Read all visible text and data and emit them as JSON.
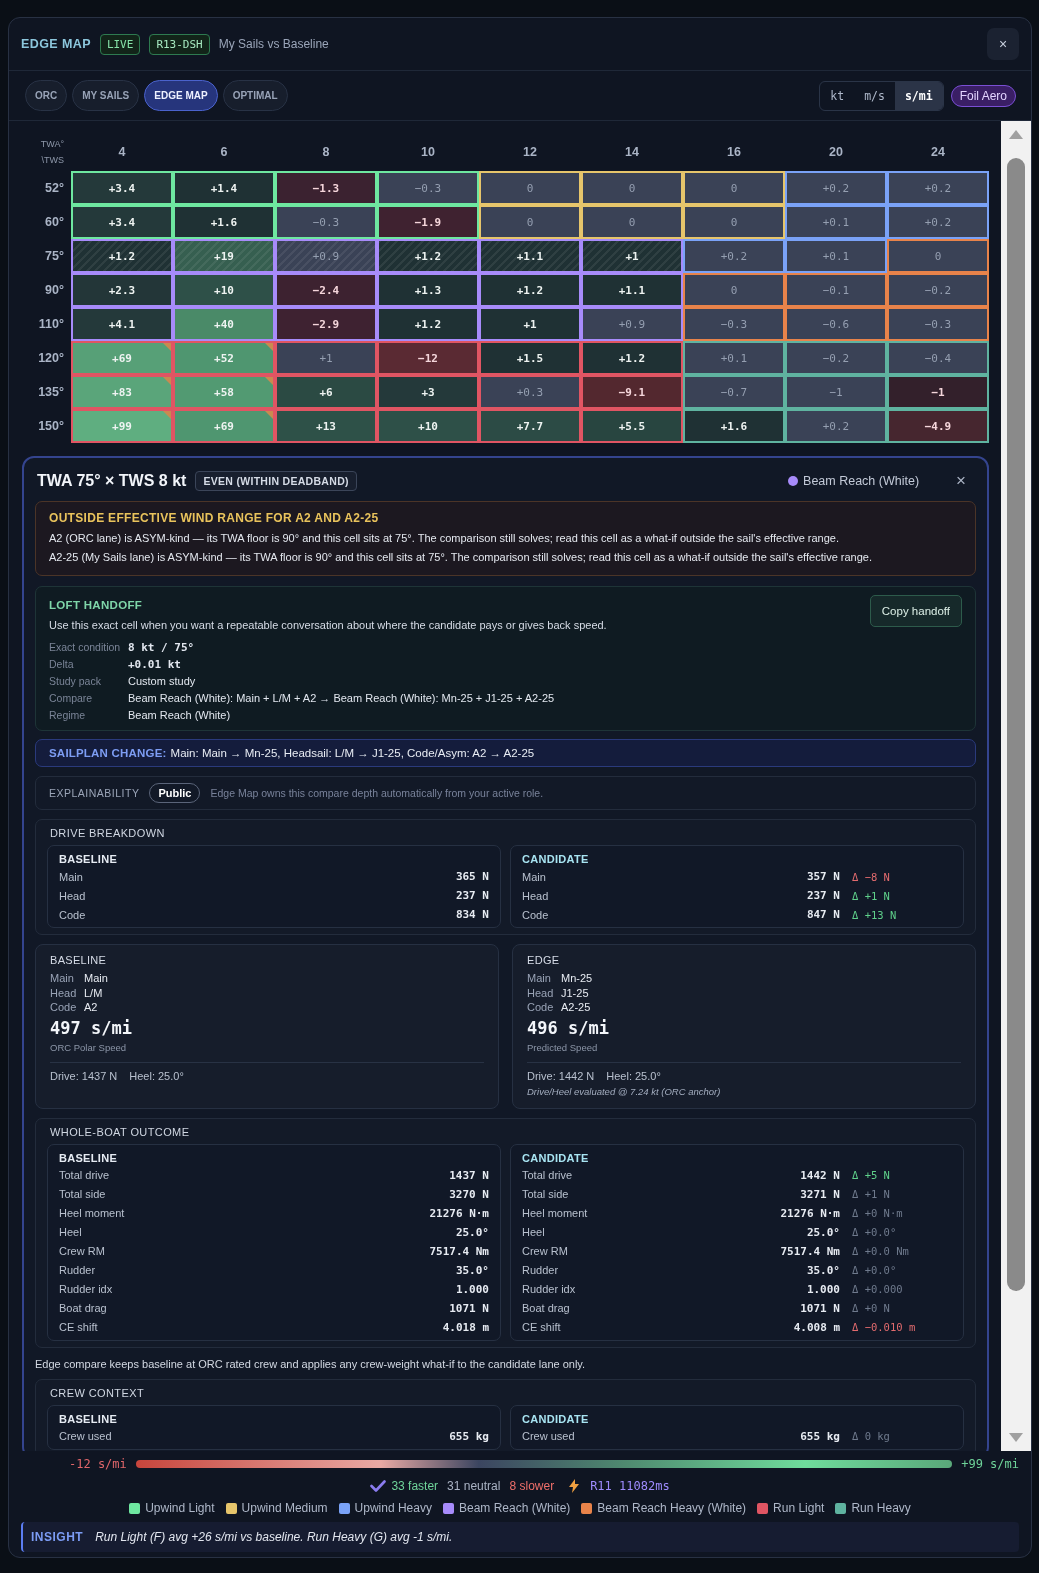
{
  "window": {
    "title": "EDGE MAP",
    "badges": [
      {
        "label": "LIVE",
        "kind": "live"
      },
      {
        "label": "R13-DSH",
        "kind": "code"
      }
    ],
    "subtitle": "My Sails vs Baseline",
    "close_label": "×"
  },
  "tabs": [
    {
      "label": "ORC",
      "selected": false
    },
    {
      "label": "MY SAILS",
      "selected": false
    },
    {
      "label": "EDGE MAP",
      "selected": true
    },
    {
      "label": "OPTIMAL",
      "selected": false
    }
  ],
  "units": [
    {
      "label": "kt",
      "selected": false
    },
    {
      "label": "m/s",
      "selected": false
    },
    {
      "label": "s/mi",
      "selected": true
    }
  ],
  "aero_badge": "Foil Aero",
  "grid": {
    "corner": [
      "TWA°",
      "\\TWS"
    ],
    "columns": [
      "4",
      "6",
      "8",
      "10",
      "12",
      "14",
      "16",
      "20",
      "24"
    ],
    "rows": [
      {
        "label": "52°",
        "cells": [
          {
            "value": "+3.4",
            "kind": "upwind_light",
            "color": "#24393a",
            "faster": true,
            "slower": false,
            "hatched": false,
            "flagged": false
          },
          {
            "value": "+1.4",
            "kind": "upwind_light",
            "color": "#1f3134",
            "faster": true,
            "slower": false,
            "hatched": false,
            "flagged": false
          },
          {
            "value": "−1.3",
            "kind": "upwind_light",
            "color": "#3b2230",
            "faster": false,
            "slower": true,
            "hatched": false,
            "flagged": false
          },
          {
            "value": "−0.3",
            "kind": "upwind_light",
            "color": "#3a4256",
            "faster": false,
            "slower": false,
            "hatched": false,
            "flagged": false
          },
          {
            "value": "0",
            "kind": "upwind_medium",
            "color": "#3a4256",
            "faster": false,
            "slower": false,
            "hatched": false,
            "flagged": false
          },
          {
            "value": "0",
            "kind": "upwind_medium",
            "color": "#3a4256",
            "faster": false,
            "slower": false,
            "hatched": false,
            "flagged": false
          },
          {
            "value": "0",
            "kind": "upwind_medium",
            "color": "#3a4256",
            "faster": false,
            "slower": false,
            "hatched": false,
            "flagged": false
          },
          {
            "value": "+0.2",
            "kind": "upwind_heavy",
            "color": "#3a4256",
            "faster": false,
            "slower": false,
            "hatched": false,
            "flagged": false
          },
          {
            "value": "+0.2",
            "kind": "upwind_heavy",
            "color": "#3a4256",
            "faster": false,
            "slower": false,
            "hatched": false,
            "flagged": false
          }
        ]
      },
      {
        "label": "60°",
        "cells": [
          {
            "value": "+3.4",
            "kind": "upwind_light",
            "color": "#24393a",
            "faster": true,
            "slower": false,
            "hatched": false,
            "flagged": false
          },
          {
            "value": "+1.6",
            "kind": "upwind_light",
            "color": "#1f3134",
            "faster": true,
            "slower": false,
            "hatched": false,
            "flagged": false
          },
          {
            "value": "−0.3",
            "kind": "upwind_light",
            "color": "#3a4256",
            "faster": false,
            "slower": false,
            "hatched": false,
            "flagged": false
          },
          {
            "value": "−1.9",
            "kind": "upwind_light",
            "color": "#3f2230",
            "faster": false,
            "slower": true,
            "hatched": false,
            "flagged": false
          },
          {
            "value": "0",
            "kind": "upwind_medium",
            "color": "#3a4256",
            "faster": false,
            "slower": false,
            "hatched": false,
            "flagged": false
          },
          {
            "value": "0",
            "kind": "upwind_medium",
            "color": "#3a4256",
            "faster": false,
            "slower": false,
            "hatched": false,
            "flagged": false
          },
          {
            "value": "0",
            "kind": "upwind_medium",
            "color": "#3a4256",
            "faster": false,
            "slower": false,
            "hatched": false,
            "flagged": false
          },
          {
            "value": "+0.1",
            "kind": "upwind_heavy",
            "color": "#3a4256",
            "faster": false,
            "slower": false,
            "hatched": false,
            "flagged": false
          },
          {
            "value": "+0.2",
            "kind": "upwind_heavy",
            "color": "#3a4256",
            "faster": false,
            "slower": false,
            "hatched": false,
            "flagged": false
          }
        ]
      },
      {
        "label": "75°",
        "cells": [
          {
            "value": "+1.2",
            "kind": "beam_reach",
            "color": "#1f3134",
            "faster": true,
            "slower": false,
            "hatched": true,
            "flagged": false
          },
          {
            "value": "+19",
            "kind": "beam_reach",
            "color": "#365f50",
            "faster": true,
            "slower": false,
            "hatched": true,
            "flagged": false
          },
          {
            "value": "+0.9",
            "kind": "beam_reach",
            "color": "#3a4256",
            "faster": false,
            "slower": false,
            "hatched": true,
            "flagged": false
          },
          {
            "value": "+1.2",
            "kind": "beam_reach",
            "color": "#1f3134",
            "faster": true,
            "slower": false,
            "hatched": true,
            "flagged": false
          },
          {
            "value": "+1.1",
            "kind": "beam_reach",
            "color": "#1f3134",
            "faster": true,
            "slower": false,
            "hatched": true,
            "flagged": false
          },
          {
            "value": "+1",
            "kind": "beam_reach",
            "color": "#1f3134",
            "faster": true,
            "slower": false,
            "hatched": true,
            "flagged": false
          },
          {
            "value": "+0.2",
            "kind": "upwind_heavy",
            "color": "#3a4256",
            "faster": false,
            "slower": false,
            "hatched": false,
            "flagged": false
          },
          {
            "value": "+0.1",
            "kind": "upwind_heavy",
            "color": "#3a4256",
            "faster": false,
            "slower": false,
            "hatched": false,
            "flagged": false
          },
          {
            "value": "0",
            "kind": "beam_reach_heavy",
            "color": "#3a4256",
            "faster": false,
            "slower": false,
            "hatched": false,
            "flagged": false
          }
        ]
      },
      {
        "label": "90°",
        "cells": [
          {
            "value": "+2.3",
            "kind": "beam_reach",
            "color": "#233638",
            "faster": true,
            "slower": false,
            "hatched": false,
            "flagged": false
          },
          {
            "value": "+10",
            "kind": "beam_reach",
            "color": "#2e5048",
            "faster": true,
            "slower": false,
            "hatched": false,
            "flagged": false
          },
          {
            "value": "−2.4",
            "kind": "beam_reach",
            "color": "#3d2230",
            "faster": false,
            "slower": true,
            "hatched": false,
            "flagged": false
          },
          {
            "value": "+1.3",
            "kind": "beam_reach",
            "color": "#1f3134",
            "faster": true,
            "slower": false,
            "hatched": false,
            "flagged": false
          },
          {
            "value": "+1.2",
            "kind": "beam_reach",
            "color": "#1f3134",
            "faster": true,
            "slower": false,
            "hatched": false,
            "flagged": false
          },
          {
            "value": "+1.1",
            "kind": "beam_reach",
            "color": "#1f3134",
            "faster": true,
            "slower": false,
            "hatched": false,
            "flagged": false
          },
          {
            "value": "0",
            "kind": "beam_reach_heavy",
            "color": "#3a4256",
            "faster": false,
            "slower": false,
            "hatched": false,
            "flagged": false
          },
          {
            "value": "−0.1",
            "kind": "beam_reach_heavy",
            "color": "#3a4256",
            "faster": false,
            "slower": false,
            "hatched": false,
            "flagged": false
          },
          {
            "value": "−0.2",
            "kind": "beam_reach_heavy",
            "color": "#3a4256",
            "faster": false,
            "slower": false,
            "hatched": false,
            "flagged": false
          }
        ]
      },
      {
        "label": "110°",
        "cells": [
          {
            "value": "+4.1",
            "kind": "beam_reach",
            "color": "#24393a",
            "faster": true,
            "slower": false,
            "hatched": false,
            "flagged": false
          },
          {
            "value": "+40",
            "kind": "beam_reach",
            "color": "#4a8a68",
            "faster": true,
            "slower": false,
            "hatched": false,
            "flagged": false
          },
          {
            "value": "−2.9",
            "kind": "beam_reach",
            "color": "#3e2231",
            "faster": false,
            "slower": true,
            "hatched": false,
            "flagged": false
          },
          {
            "value": "+1.2",
            "kind": "beam_reach",
            "color": "#1f3134",
            "faster": true,
            "slower": false,
            "hatched": false,
            "flagged": false
          },
          {
            "value": "+1",
            "kind": "beam_reach",
            "color": "#1f3134",
            "faster": true,
            "slower": false,
            "hatched": false,
            "flagged": false
          },
          {
            "value": "+0.9",
            "kind": "beam_reach",
            "color": "#3a4256",
            "faster": false,
            "slower": false,
            "hatched": false,
            "flagged": false
          },
          {
            "value": "−0.3",
            "kind": "beam_reach_heavy",
            "color": "#3a4256",
            "faster": false,
            "slower": false,
            "hatched": false,
            "flagged": false
          },
          {
            "value": "−0.6",
            "kind": "beam_reach_heavy",
            "color": "#3a4256",
            "faster": false,
            "slower": false,
            "hatched": false,
            "flagged": false
          },
          {
            "value": "−0.3",
            "kind": "beam_reach_heavy",
            "color": "#3a4256",
            "faster": false,
            "slower": false,
            "hatched": false,
            "flagged": false
          }
        ]
      },
      {
        "label": "120°",
        "cells": [
          {
            "value": "+69",
            "kind": "run_light",
            "color": "#57a077",
            "faster": true,
            "slower": false,
            "hatched": false,
            "flagged": true
          },
          {
            "value": "+52",
            "kind": "run_light",
            "color": "#4f9670",
            "faster": true,
            "slower": false,
            "hatched": false,
            "flagged": true
          },
          {
            "value": "+1",
            "kind": "run_light",
            "color": "#3a4256",
            "faster": false,
            "slower": false,
            "hatched": false,
            "flagged": false
          },
          {
            "value": "−12",
            "kind": "run_light",
            "color": "#5a2a33",
            "faster": false,
            "slower": true,
            "hatched": false,
            "flagged": false
          },
          {
            "value": "+1.5",
            "kind": "run_light",
            "color": "#1f3134",
            "faster": true,
            "slower": false,
            "hatched": false,
            "flagged": false
          },
          {
            "value": "+1.2",
            "kind": "run_light",
            "color": "#1f3134",
            "faster": true,
            "slower": false,
            "hatched": false,
            "flagged": false
          },
          {
            "value": "+0.1",
            "kind": "run_heavy",
            "color": "#3a4256",
            "faster": false,
            "slower": false,
            "hatched": false,
            "flagged": false
          },
          {
            "value": "−0.2",
            "kind": "run_heavy",
            "color": "#3a4256",
            "faster": false,
            "slower": false,
            "hatched": false,
            "flagged": false
          },
          {
            "value": "−0.4",
            "kind": "run_heavy",
            "color": "#3a4256",
            "faster": false,
            "slower": false,
            "hatched": false,
            "flagged": false
          }
        ]
      },
      {
        "label": "135°",
        "cells": [
          {
            "value": "+83",
            "kind": "run_light",
            "color": "#5aa57a",
            "faster": true,
            "slower": false,
            "hatched": false,
            "flagged": true
          },
          {
            "value": "+58",
            "kind": "run_light",
            "color": "#529a72",
            "faster": true,
            "slower": false,
            "hatched": false,
            "flagged": true
          },
          {
            "value": "+6",
            "kind": "run_light",
            "color": "#2b4a43",
            "faster": true,
            "slower": false,
            "hatched": false,
            "flagged": false
          },
          {
            "value": "+3",
            "kind": "run_light",
            "color": "#24393a",
            "faster": true,
            "slower": false,
            "hatched": false,
            "flagged": false
          },
          {
            "value": "+0.3",
            "kind": "run_light",
            "color": "#3a4256",
            "faster": false,
            "slower": false,
            "hatched": false,
            "flagged": false
          },
          {
            "value": "−9.1",
            "kind": "run_light",
            "color": "#53282f",
            "faster": false,
            "slower": true,
            "hatched": false,
            "flagged": false
          },
          {
            "value": "−0.7",
            "kind": "run_heavy",
            "color": "#3a4256",
            "faster": false,
            "slower": false,
            "hatched": false,
            "flagged": false
          },
          {
            "value": "−1",
            "kind": "run_heavy",
            "color": "#3a4256",
            "faster": false,
            "slower": false,
            "hatched": false,
            "flagged": false
          },
          {
            "value": "−1",
            "kind": "run_heavy",
            "color": "#33202b",
            "faster": false,
            "slower": true,
            "hatched": false,
            "flagged": false
          }
        ]
      },
      {
        "label": "150°",
        "cells": [
          {
            "value": "+99",
            "kind": "run_light",
            "color": "#5fae80",
            "faster": true,
            "slower": false,
            "hatched": false,
            "flagged": true
          },
          {
            "value": "+69",
            "kind": "run_light",
            "color": "#4f9670",
            "faster": true,
            "slower": false,
            "hatched": false,
            "flagged": true
          },
          {
            "value": "+13",
            "kind": "run_light",
            "color": "#2e5148",
            "faster": true,
            "slower": false,
            "hatched": false,
            "flagged": false
          },
          {
            "value": "+10",
            "kind": "run_light",
            "color": "#2e5048",
            "faster": true,
            "slower": false,
            "hatched": false,
            "flagged": false
          },
          {
            "value": "+7.7",
            "kind": "run_light",
            "color": "#2c4b45",
            "faster": true,
            "slower": false,
            "hatched": false,
            "flagged": false
          },
          {
            "value": "+5.5",
            "kind": "run_light",
            "color": "#284540",
            "faster": true,
            "slower": false,
            "hatched": false,
            "flagged": false
          },
          {
            "value": "+1.6",
            "kind": "run_heavy",
            "color": "#1f3134",
            "faster": true,
            "slower": false,
            "hatched": false,
            "flagged": false
          },
          {
            "value": "+0.2",
            "kind": "run_heavy",
            "color": "#3a4256",
            "faster": false,
            "slower": false,
            "hatched": false,
            "flagged": false
          },
          {
            "value": "−4.9",
            "kind": "run_heavy",
            "color": "#46262f",
            "faster": false,
            "slower": true,
            "hatched": false,
            "flagged": false
          }
        ]
      }
    ]
  },
  "detail": {
    "title": "TWA 75° × TWS 8 kt",
    "verdict": "EVEN (WITHIN DEADBAND)",
    "regime": {
      "label": "Beam Reach (White)",
      "color": "#a78bfa"
    },
    "close_label": "×",
    "warning": {
      "title": "OUTSIDE EFFECTIVE WIND RANGE FOR A2 AND A2-25",
      "lines": [
        "A2 (ORC lane) is ASYM-kind — its TWA floor is 90° and this cell sits at 75°. The comparison still solves; read this cell as a what-if outside the sail's effective range.",
        "A2-25 (My Sails lane) is ASYM-kind — its TWA floor is 90° and this cell sits at 75°. The comparison still solves; read this cell as a what-if outside the sail's effective range."
      ]
    },
    "handoff": {
      "title": "LOFT HANDOFF",
      "description": "Use this exact cell when you want a repeatable conversation about where the candidate pays or gives back speed.",
      "button": "Copy handoff",
      "fields": [
        {
          "label": "Exact condition",
          "value": "8 kt / 75°",
          "kind": "mono"
        },
        {
          "label": "Delta",
          "value": "+0.01 kt",
          "kind": "mono"
        },
        {
          "label": "Study pack",
          "value": "Custom study",
          "kind": "text"
        },
        {
          "label": "Compare",
          "value": "Beam Reach (White): Main + L/M + A2 → Beam Reach (White): Mn-25 + J1-25 + A2-25",
          "kind": "text"
        },
        {
          "label": "Regime",
          "value": "Beam Reach (White)",
          "kind": "text"
        }
      ]
    },
    "sailplan": {
      "label": "SAILPLAN CHANGE:",
      "text": "Main: Main → Mn-25, Headsail: L/M → J1-25, Code/Asym: A2 → A2-25"
    },
    "explainability": {
      "label": "EXPLAINABILITY",
      "role": "Public",
      "note": "Edge Map owns this compare depth automatically from your active role."
    },
    "drive_breakdown": {
      "title": "DRIVE BREAKDOWN",
      "lanes": [
        {
          "title": "BASELINE",
          "kind": "baseline",
          "rows": [
            {
              "label": "Main",
              "value": "365 N"
            },
            {
              "label": "Head",
              "value": "237 N"
            },
            {
              "label": "Code",
              "value": "834 N"
            }
          ]
        },
        {
          "title": "CANDIDATE",
          "kind": "candidate",
          "rows": [
            {
              "label": "Main",
              "value": "357 N",
              "delta": "Δ −8 N",
              "kind": "down"
            },
            {
              "label": "Head",
              "value": "237 N",
              "delta": "Δ +1 N",
              "kind": "up"
            },
            {
              "label": "Code",
              "value": "847 N",
              "delta": "Δ +13 N",
              "kind": "up"
            }
          ]
        }
      ]
    },
    "lane_cards": [
      {
        "title": "BASELINE",
        "sails": [
          {
            "label": "Main",
            "value": "Main"
          },
          {
            "label": "Head",
            "value": "L/M"
          },
          {
            "label": "Code",
            "value": "A2"
          }
        ],
        "speed": "497 s/mi",
        "speed_caption": "ORC Polar Speed",
        "drive": "Drive: 1437 N",
        "heel": "Heel: 25.0°"
      },
      {
        "title": "EDGE",
        "sails": [
          {
            "label": "Main",
            "value": "Mn-25"
          },
          {
            "label": "Head",
            "value": "J1-25"
          },
          {
            "label": "Code",
            "value": "A2-25"
          }
        ],
        "speed": "496 s/mi",
        "speed_caption": "Predicted Speed",
        "drive": "Drive: 1442 N",
        "heel": "Heel: 25.0°",
        "note": "Drive/Heel evaluated @ 7.24 kt (ORC anchor)"
      }
    ],
    "whole_boat": {
      "title": "WHOLE-BOAT OUTCOME",
      "lanes": [
        {
          "title": "BASELINE",
          "kind": "baseline",
          "rows": [
            {
              "label": "Total drive",
              "value": "1437 N"
            },
            {
              "label": "Total side",
              "value": "3270 N"
            },
            {
              "label": "Heel moment",
              "value": "21276 N·m"
            },
            {
              "label": "Heel",
              "value": "25.0°"
            },
            {
              "label": "Crew RM",
              "value": "7517.4 Nm"
            },
            {
              "label": "Rudder",
              "value": "35.0°"
            },
            {
              "label": "Rudder idx",
              "value": "1.000"
            },
            {
              "label": "Boat drag",
              "value": "1071 N"
            },
            {
              "label": "CE shift",
              "value": "4.018 m"
            }
          ]
        },
        {
          "title": "CANDIDATE",
          "kind": "candidate",
          "rows": [
            {
              "label": "Total drive",
              "value": "1442 N",
              "delta": "Δ +5 N",
              "kind": "up"
            },
            {
              "label": "Total side",
              "value": "3271 N",
              "delta": "Δ +1 N",
              "kind": "flat"
            },
            {
              "label": "Heel moment",
              "value": "21276 N·m",
              "delta": "Δ +0 N·m",
              "kind": "flat"
            },
            {
              "label": "Heel",
              "value": "25.0°",
              "delta": "Δ +0.0°",
              "kind": "flat"
            },
            {
              "label": "Crew RM",
              "value": "7517.4 Nm",
              "delta": "Δ +0.0 Nm",
              "kind": "flat"
            },
            {
              "label": "Rudder",
              "value": "35.0°",
              "delta": "Δ +0.0°",
              "kind": "flat"
            },
            {
              "label": "Rudder idx",
              "value": "1.000",
              "delta": "Δ +0.000",
              "kind": "flat"
            },
            {
              "label": "Boat drag",
              "value": "1071 N",
              "delta": "Δ +0 N",
              "kind": "flat"
            },
            {
              "label": "CE shift",
              "value": "4.008 m",
              "delta": "Δ −0.010 m",
              "kind": "down"
            }
          ]
        }
      ]
    },
    "crew_note": "Edge compare keeps baseline at ORC rated crew and applies any crew-weight what-if to the candidate lane only.",
    "crew_context": {
      "title": "CREW CONTEXT",
      "lanes": [
        {
          "title": "BASELINE",
          "kind": "baseline",
          "rows": [
            {
              "label": "Crew used",
              "value": "655 kg"
            }
          ]
        },
        {
          "title": "CANDIDATE",
          "kind": "candidate",
          "rows": [
            {
              "label": "Crew used",
              "value": "655 kg",
              "delta": "Δ 0 kg",
              "kind": "flat"
            }
          ]
        }
      ]
    }
  },
  "scale": {
    "min_label": "-12 s/mi",
    "max_label": "+99 s/mi"
  },
  "summary": {
    "faster": "33 faster",
    "neutral": "31 neutral",
    "slower": "8 slower",
    "run": "R11 11082ms"
  },
  "legend": [
    {
      "label": "Upwind Light",
      "kind": "upwind_light",
      "color": "#6ee7a0"
    },
    {
      "label": "Upwind Medium",
      "kind": "upwind_medium",
      "color": "#e6c56b"
    },
    {
      "label": "Upwind Heavy",
      "kind": "upwind_heavy",
      "color": "#7aa2f7"
    },
    {
      "label": "Beam Reach (White)",
      "kind": "beam_reach",
      "color": "#a78bfa"
    },
    {
      "label": "Beam Reach Heavy (White)",
      "kind": "beam_reach_heavy",
      "color": "#e8834a"
    },
    {
      "label": "Run Light",
      "kind": "run_light",
      "color": "#e05563"
    },
    {
      "label": "Run Heavy",
      "kind": "run_heavy",
      "color": "#5fb3a0"
    }
  ],
  "insight": {
    "label": "INSIGHT",
    "text": "Run Light (F) avg +26 s/mi vs baseline. Run Heavy (G) avg -1 s/mi."
  }
}
